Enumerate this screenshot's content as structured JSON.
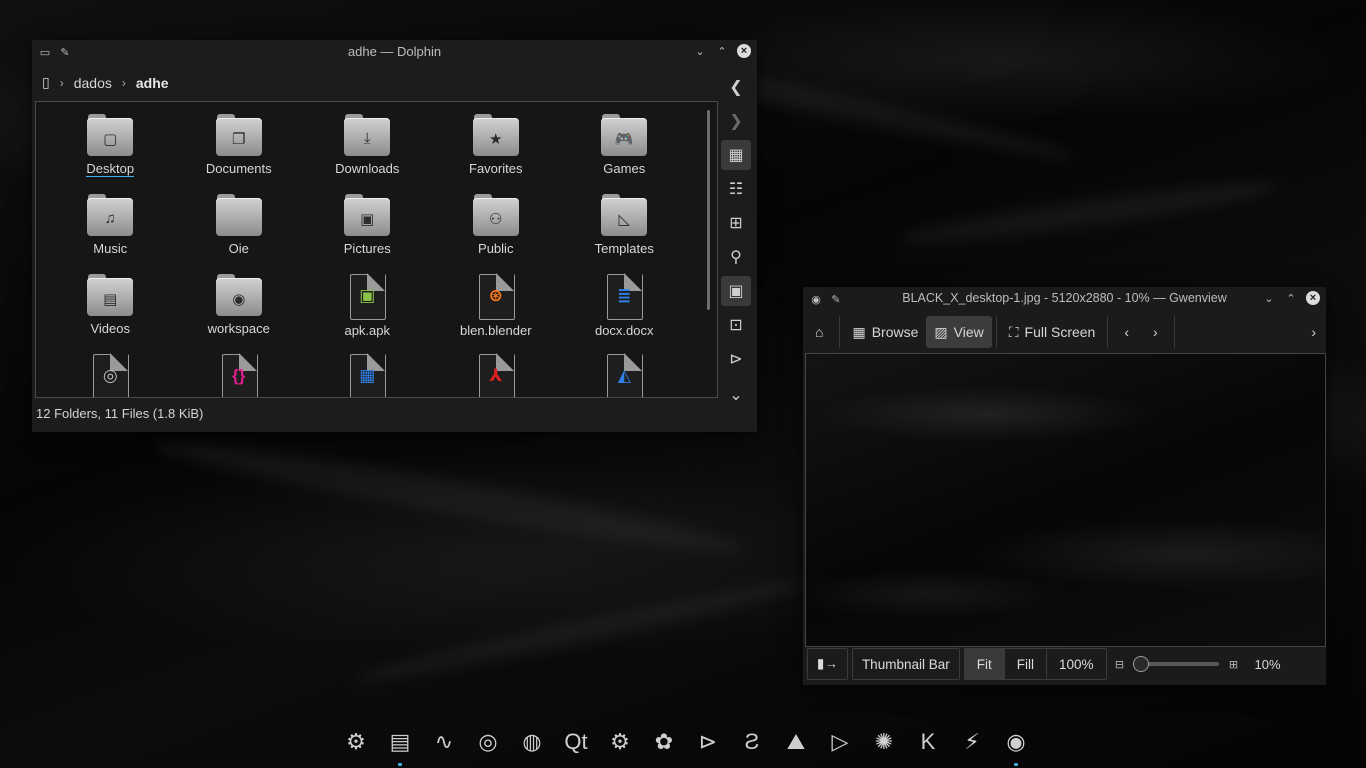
{
  "dolphin": {
    "title": "adhe — Dolphin",
    "breadcrumb": [
      "dados",
      "adhe"
    ],
    "items": [
      {
        "label": "Desktop",
        "kind": "folder",
        "glyph": "▢"
      },
      {
        "label": "Documents",
        "kind": "folder",
        "glyph": "❐"
      },
      {
        "label": "Downloads",
        "kind": "folder",
        "glyph": "⤓"
      },
      {
        "label": "Favorites",
        "kind": "folder",
        "glyph": "★"
      },
      {
        "label": "Games",
        "kind": "folder",
        "glyph": "🎮"
      },
      {
        "label": "Music",
        "kind": "folder",
        "glyph": "♫"
      },
      {
        "label": "Oie",
        "kind": "folder",
        "glyph": ""
      },
      {
        "label": "Pictures",
        "kind": "folder",
        "glyph": "▣"
      },
      {
        "label": "Public",
        "kind": "folder",
        "glyph": "⚇"
      },
      {
        "label": "Templates",
        "kind": "folder",
        "glyph": "◺"
      },
      {
        "label": "Videos",
        "kind": "folder",
        "glyph": "▤"
      },
      {
        "label": "workspace",
        "kind": "folder",
        "glyph": "◉"
      },
      {
        "label": "apk.apk",
        "kind": "file",
        "glyph": "▣",
        "color": "#8bc34a"
      },
      {
        "label": "blen.blender",
        "kind": "file",
        "glyph": "⊛",
        "color": "#ff7a1a"
      },
      {
        "label": "docx.docx",
        "kind": "file",
        "glyph": "≣",
        "color": "#2f7fe6"
      },
      {
        "label": "",
        "kind": "file",
        "glyph": "◎",
        "color": "#bdbdbd"
      },
      {
        "label": "",
        "kind": "file",
        "glyph": "{}",
        "color": "#e0208f"
      },
      {
        "label": "",
        "kind": "file",
        "glyph": "▦",
        "color": "#2f7fe6"
      },
      {
        "label": "",
        "kind": "file",
        "glyph": "⅄",
        "color": "#e02020"
      },
      {
        "label": "",
        "kind": "file",
        "glyph": "◭",
        "color": "#2f7fe6"
      }
    ],
    "status": "12 Folders, 11 Files (1.8 KiB)"
  },
  "gwenview": {
    "title": "BLACK_X_desktop-1.jpg - 5120x2880 - 10% — Gwenview",
    "toolbar": {
      "browse": "Browse",
      "view": "View",
      "fullscreen": "Full Screen"
    },
    "bottom": {
      "thumbnail_bar": "Thumbnail Bar",
      "fit": "Fit",
      "fill": "Fill",
      "hundred": "100%",
      "zoom": "10%"
    },
    "zoom_fraction": 0.0
  },
  "colors": {
    "accent": "#3daee9",
    "window_bg": "#1c1c1c"
  },
  "dock": [
    "settings-icon",
    "files-icon",
    "system-monitor-icon",
    "browser-icon",
    "browser-globe-icon",
    "qt-icon",
    "update-icon",
    "gimp-icon",
    "terminal-icon",
    "sublime-icon",
    "inkscape-icon",
    "media-player-icon",
    "krita-icon",
    "kdenlive-icon",
    "waveform-icon",
    "eye-icon"
  ]
}
